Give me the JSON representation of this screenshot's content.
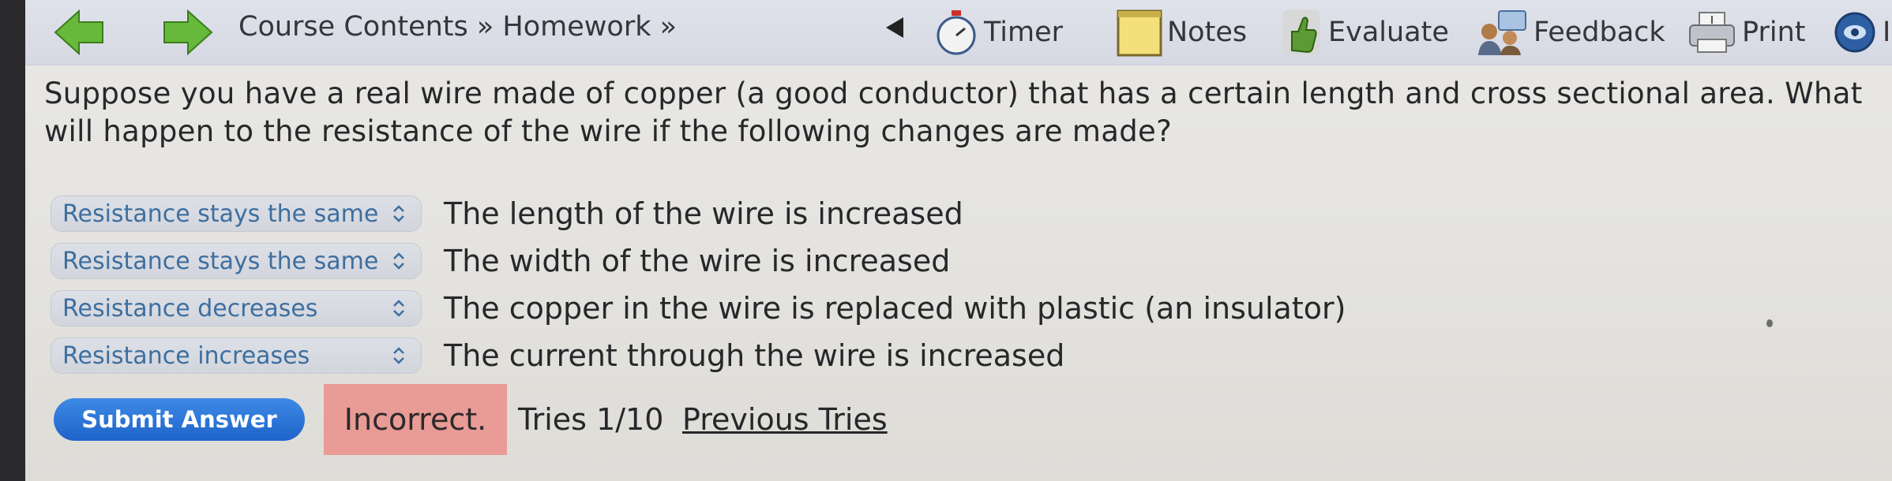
{
  "nav": {
    "back_label": "",
    "forward_label": "",
    "breadcrumb": "Course Contents » Homework »"
  },
  "toolbar": {
    "timer_label": "Timer",
    "notes_label": "Notes",
    "evaluate_label": "Evaluate",
    "feedback_label": "Feedback",
    "print_label": "Print",
    "info_label": "In"
  },
  "question": {
    "text": "Suppose you have a real wire made of copper (a good conductor) that has a certain length and cross sectional area. What will happen to the resistance of the wire if the following changes are made?"
  },
  "items": [
    {
      "selected": "Resistance stays the same",
      "statement": "The length of the wire is increased"
    },
    {
      "selected": "Resistance stays the same",
      "statement": "The width of the wire is increased"
    },
    {
      "selected": "Resistance decreases",
      "statement": "The copper in the wire is replaced with plastic (an insulator)"
    },
    {
      "selected": "Resistance increases",
      "statement": "The current through the wire is increased"
    }
  ],
  "submission": {
    "submit_label": "Submit Answer",
    "result": "Incorrect.",
    "tries": "Tries 1/10",
    "previous_tries_label": "Previous Tries"
  },
  "colors": {
    "submit_blue": "#1f63c9",
    "incorrect_bg": "#e99b96",
    "select_text": "#3d6fa0",
    "arrow_green": "#5fb233"
  }
}
